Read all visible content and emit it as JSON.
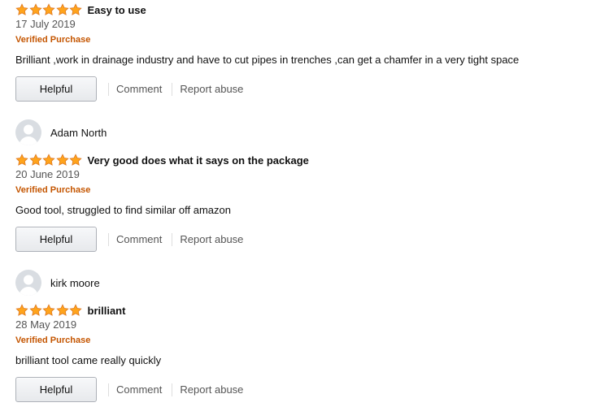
{
  "colors": {
    "star_fill": "#ffa41c",
    "star_stroke": "#de7921",
    "verified": "#c45500",
    "button_border": "#adb1b8"
  },
  "reviews": [
    {
      "reviewer": "",
      "rating": 5,
      "title": "Easy to use",
      "date": "17 July 2019",
      "verified": "Verified Purchase",
      "body": "Brilliant ,work in drainage industry and have to cut pipes in trenches ,can get a chamfer in a very tight space",
      "helpful_label": "Helpful",
      "comment_label": "Comment",
      "report_label": "Report abuse"
    },
    {
      "reviewer": "Adam North",
      "rating": 5,
      "title": "Very good does what it says on the package",
      "date": "20 June 2019",
      "verified": "Verified Purchase",
      "body": "Good tool, struggled to find similar off amazon",
      "helpful_label": "Helpful",
      "comment_label": "Comment",
      "report_label": "Report abuse"
    },
    {
      "reviewer": "kirk moore",
      "rating": 5,
      "title": "brilliant",
      "date": "28 May 2019",
      "verified": "Verified Purchase",
      "body": "brilliant tool came really quickly",
      "helpful_label": "Helpful",
      "comment_label": "Comment",
      "report_label": "Report abuse"
    }
  ]
}
